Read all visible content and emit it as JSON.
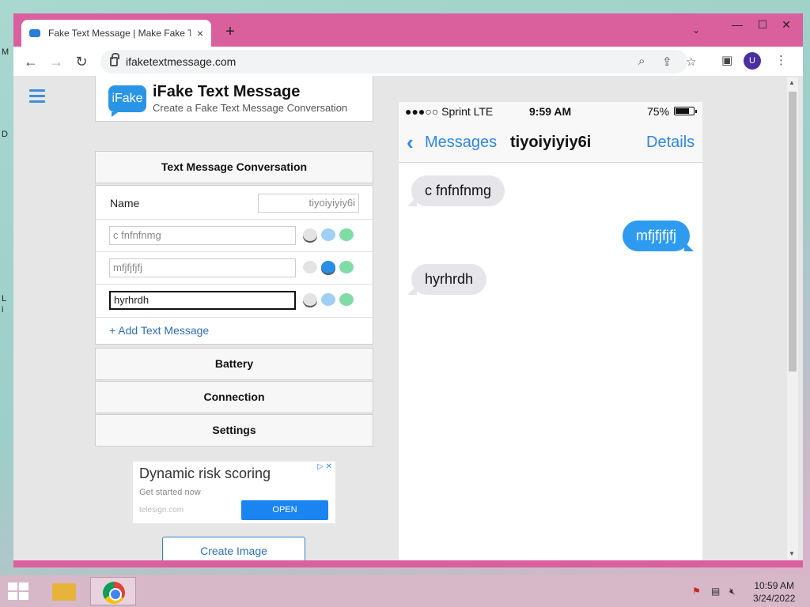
{
  "desktop": {
    "glyphs": [
      "M",
      "D",
      "L",
      "i"
    ]
  },
  "browser": {
    "tab_title": "Fake Text Message | Make Fake T",
    "tab_close": "×",
    "new_tab": "+",
    "minimize": "—",
    "maximize": "☐",
    "close": "✕",
    "tab_list": "⌄",
    "back": "←",
    "forward": "→",
    "reload": "↻",
    "url": "ifaketextmessage.com",
    "avatar_initial": "U"
  },
  "app": {
    "logo_badge": "iFake",
    "logo_title": "iFake Text Message",
    "logo_subtitle": "Create a Fake Text Message Conversation",
    "section_conversation": "Text Message Conversation",
    "name_label": "Name",
    "name_value": "tiyoiyiyiy6i",
    "messages": [
      {
        "text": "c fnfnfnmg",
        "type": "gray"
      },
      {
        "text": "mfjfjfjfj",
        "type": "blue"
      },
      {
        "text": "hyrhrdh",
        "type": "gray"
      }
    ],
    "add_message": "+ Add Text Message",
    "section_battery": "Battery",
    "section_connection": "Connection",
    "section_settings": "Settings",
    "create_image": "Create Image"
  },
  "ad": {
    "title": "Dynamic risk scoring",
    "subtitle": "Get started now",
    "domain": "telesign.com",
    "button": "OPEN",
    "close": "▷ ✕"
  },
  "phone": {
    "carrier": "●●●○○ Sprint  LTE",
    "time": "9:59 AM",
    "battery": "75%",
    "back_label": "Messages",
    "contact": "tiyoiyiyiy6i",
    "details": "Details",
    "bubbles": [
      {
        "text": "c fnfnfnmg",
        "side": "received"
      },
      {
        "text": "mfjfjfjfj",
        "side": "sent"
      },
      {
        "text": "hyrhrdh",
        "side": "received"
      }
    ]
  },
  "taskbar": {
    "time": "10:59 AM",
    "date": "3/24/2022"
  },
  "colors": {
    "accent_blue": "#2e86e0",
    "sent_bubble": "#2e9bf0",
    "received_bubble": "#e5e5ea",
    "window_frame": "#d9609d"
  }
}
